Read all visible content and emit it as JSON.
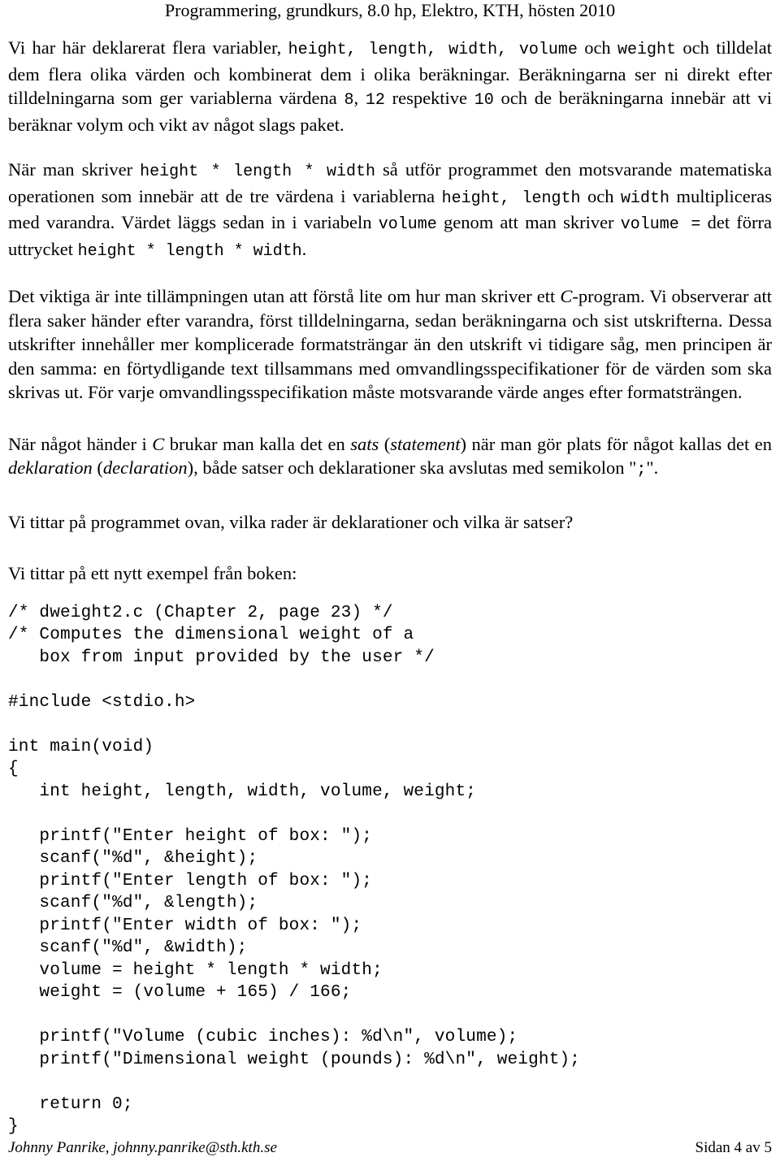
{
  "header": {
    "title": "Programmering, grundkurs, 8.0 hp, Elektro, KTH, hösten 2010"
  },
  "paragraphs": {
    "p1": {
      "seg1": "Vi har här deklarerat flera variabler, ",
      "code1": "height, length, width, volume",
      "seg2": " och ",
      "code2": "weight",
      "seg3": " och tilldelat dem flera olika värden och kombinerat dem i olika beräkningar. Beräkningarna ser ni direkt efter tilldelningarna som ger variablerna värdena ",
      "code3": "8",
      "seg4": ", ",
      "code4": "12",
      "seg5": " respektive ",
      "code5": "10",
      "seg6": " och de beräkningarna innebär att vi beräknar volym och vikt av något slags paket."
    },
    "p2": {
      "seg1": "När man skriver ",
      "code1": "height * length * width",
      "seg2": " så utför programmet den motsvarande matematiska operationen som innebär att de tre värdena i variablerna ",
      "code2": "height, length",
      "seg3": " och ",
      "code3": "width",
      "seg4": " multipliceras med varandra. Värdet läggs sedan in i variabeln ",
      "code4": "volume",
      "seg5": " genom att man skriver ",
      "code5": "volume =",
      "seg6": " det förra uttrycket ",
      "code6": "height * length * width",
      "seg7": "."
    },
    "p3": {
      "seg1": "Det viktiga är inte tillämpningen utan att förstå lite om hur man skriver ett ",
      "em1": "C",
      "seg2": "-program. Vi observerar att flera saker händer efter varandra, först tilldelningarna, sedan beräkningarna och sist utskrifterna. Dessa utskrifter innehåller mer komplicerade formatsträngar än den utskrift vi tidigare såg, men principen är den samma: en förtydligande text tillsammans med omvandlingsspecifikationer för de värden som ska skrivas ut. För varje omvandlingsspecifikation måste motsvarande värde anges efter formatsträngen."
    },
    "p4": {
      "seg1": "När något händer i ",
      "em1": "C",
      "seg2": " brukar man kalla det en ",
      "em2": "sats",
      "seg3": " (",
      "em3": "statement",
      "seg4": ") när man gör plats för något kallas det en ",
      "em4": "deklaration",
      "seg5": " (",
      "em5": "declaration",
      "seg6": "), både satser och deklarationer ska avslutas med semikolon \"",
      "code1": ";",
      "seg7": "\"."
    },
    "p5": "Vi tittar på programmet ovan, vilka rader är deklarationer och vilka är satser?",
    "p6": "Vi tittar på ett nytt exempel från boken:"
  },
  "code": {
    "text": "/* dweight2.c (Chapter 2, page 23) */\n/* Computes the dimensional weight of a\n   box from input provided by the user */\n\n#include <stdio.h>\n\nint main(void)\n{\n   int height, length, width, volume, weight;\n\n   printf(\"Enter height of box: \");\n   scanf(\"%d\", &height);\n   printf(\"Enter length of box: \");\n   scanf(\"%d\", &length);\n   printf(\"Enter width of box: \");\n   scanf(\"%d\", &width);\n   volume = height * length * width;\n   weight = (volume + 165) / 166;\n\n   printf(\"Volume (cubic inches): %d\\n\", volume);\n   printf(\"Dimensional weight (pounds): %d\\n\", weight);\n\n   return 0;\n}"
  },
  "footer": {
    "author": "Johnny Panrike, johnny.panrike@sth.kth.se",
    "page": "Sidan 4 av 5"
  }
}
